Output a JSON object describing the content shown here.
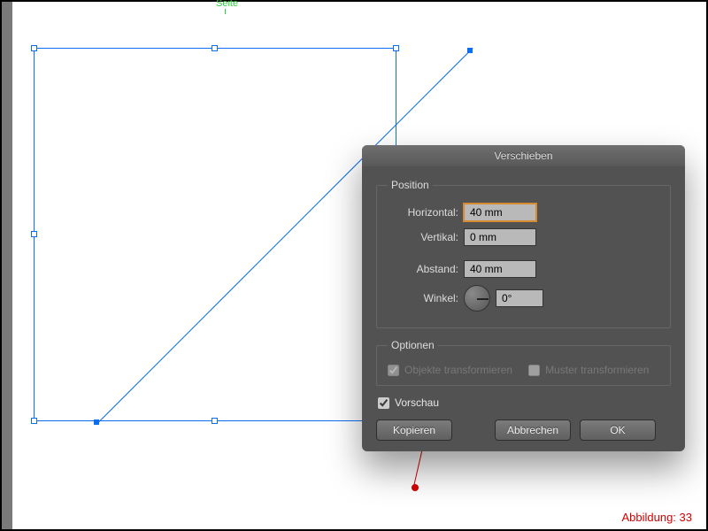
{
  "canvas": {
    "seite_label": "Seite"
  },
  "dialog": {
    "title": "Verschieben",
    "position": {
      "legend": "Position",
      "horizontal_label": "Horizontal:",
      "horizontal_value": "40 mm",
      "vertikal_label": "Vertikal:",
      "vertikal_value": "0 mm",
      "abstand_label": "Abstand:",
      "abstand_value": "40 mm",
      "winkel_label": "Winkel:",
      "winkel_value": "0°"
    },
    "optionen": {
      "legend": "Optionen",
      "objekte_label": "Objekte transformieren",
      "muster_label": "Muster transformieren"
    },
    "vorschau_label": "Vorschau",
    "buttons": {
      "kopieren": "Kopieren",
      "abbrechen": "Abbrechen",
      "ok": "OK"
    }
  },
  "caption": "Abbildung: 33"
}
